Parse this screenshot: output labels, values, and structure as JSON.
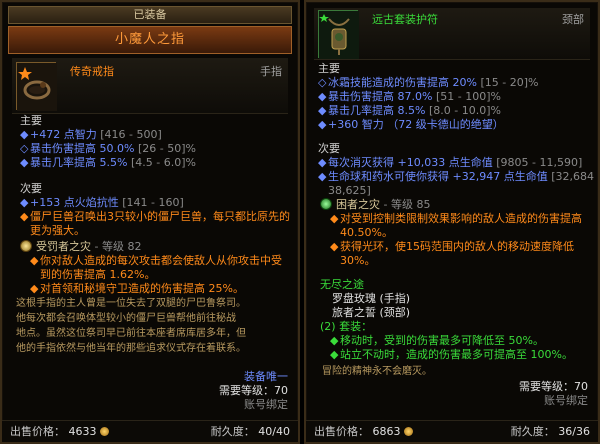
{
  "left": {
    "equipped_label": "已装备",
    "item_name": "小魔人之指",
    "item_type": "传奇戒指",
    "slot": "手指",
    "primary_label": "主要",
    "primary": [
      {
        "text": "+472 点智力",
        "range": "[416 - 500]"
      },
      {
        "text": "暴击伤害提高 50.0%",
        "range": "[26 - 50]%"
      },
      {
        "text": "暴击几率提高 5.5%",
        "range": "[4.5 - 6.0]%"
      }
    ],
    "secondary_label": "次要",
    "secondary": [
      {
        "text": "+153 点火焰抗性",
        "range": "[141 - 160]"
      }
    ],
    "legendary_power": "僵尸巨兽召唤出3只较小的僵尸巨兽，每只都比原先的更为强大。",
    "legendary_power_line1": "僵尸巨兽召唤出3只较小的僵尸巨兽，每只都比原先的",
    "legendary_power_line2": "更为强大。",
    "gem_name": "受罚者之灾",
    "gem_rank": "- 等级 82",
    "gem_effects": [
      {
        "line1": "你对敌人造成的每次攻击都会使敌人从你攻击中受",
        "line2": "到的伤害提高 1.62%。",
        "highlight": "1.62%"
      },
      {
        "line1": "对首领和秘境守卫造成的伤害提高 25%。",
        "line2": "",
        "highlight": "25%"
      }
    ],
    "flavor": [
      "这根手指的主人曾是一位失去了双腿的尸巴鲁祭司。",
      "他每次都会召唤体型较小的僵尸巨兽帮他前往秘战",
      "地点。虽然这位祭司早已前往本座者席库居多年，但",
      "他的手指依然与他当年的那些追求仪式存在着联系。"
    ],
    "unique_equipped": "装备唯一",
    "level_req": "需要等级：70",
    "account_bound": "账号绑定",
    "sell_label": "出售价格：",
    "sell_value": "4633",
    "durability_label": "耐久度：",
    "durability_value": "40/40"
  },
  "right": {
    "item_type": "远古套装护符",
    "slot": "颈部",
    "primary_label": "主要",
    "primary": [
      {
        "text": "冰霜技能造成的伤害提高 20%",
        "range": "[15 - 20]%"
      },
      {
        "text": "暴击伤害提高 87.0%",
        "range": "[51 - 100]%"
      },
      {
        "text": "暴击几率提高 8.5%",
        "range": "[8.0 - 10.0]%"
      },
      {
        "text": "+360 智力",
        "range": "（72 级卡德山的绝望）"
      }
    ],
    "secondary_label": "次要",
    "secondary": [
      {
        "text": "每次消灭获得 +10,033 点生命值",
        "range": "[9805 - 11,590]"
      },
      {
        "text": "生命球和药水可使你获得 +32,947 点生命值",
        "range": "[32,684 -"
      },
      {
        "text": "",
        "range": "38,625]"
      }
    ],
    "gem_name": "困者之灾",
    "gem_rank": "- 等级 85",
    "gem_effects": [
      {
        "line1": "对受到控制类限制效果影响的敌人造成的伤害提高",
        "line2": "40.50%。"
      },
      {
        "line1": "获得光环，使15码范围内的敌人的移动速度降低",
        "line2": "30%。"
      }
    ],
    "set_name": "无尽之途",
    "set_items": [
      "罗盘玫瑰 (手指)",
      "旅者之誓 (颈部)"
    ],
    "set_bonus_label": "(2) 套装：",
    "set_bonuses": [
      "移动时，受到的伤害最多可降低至 50%。",
      "站立不动时，造成的伤害最多可提高至 100%。"
    ],
    "flavor": "冒险的精神永不会磨灭。",
    "level_req": "需要等级：70",
    "account_bound": "账号绑定",
    "sell_label": "出售价格：",
    "sell_value": "6863",
    "durability_label": "耐久度：",
    "durability_value": "36/36"
  },
  "icons": {
    "ring": "ring-icon",
    "amulet": "amulet-icon",
    "coin": "gold-coin-icon",
    "gem": "gem-icon"
  },
  "colors": {
    "legendary_title": "#ff8a1a",
    "magic_affix": "#6e8cff",
    "set_green": "#3adc3a",
    "range_gray": "#8a8a8a",
    "gold_text": "#c8a45a"
  }
}
